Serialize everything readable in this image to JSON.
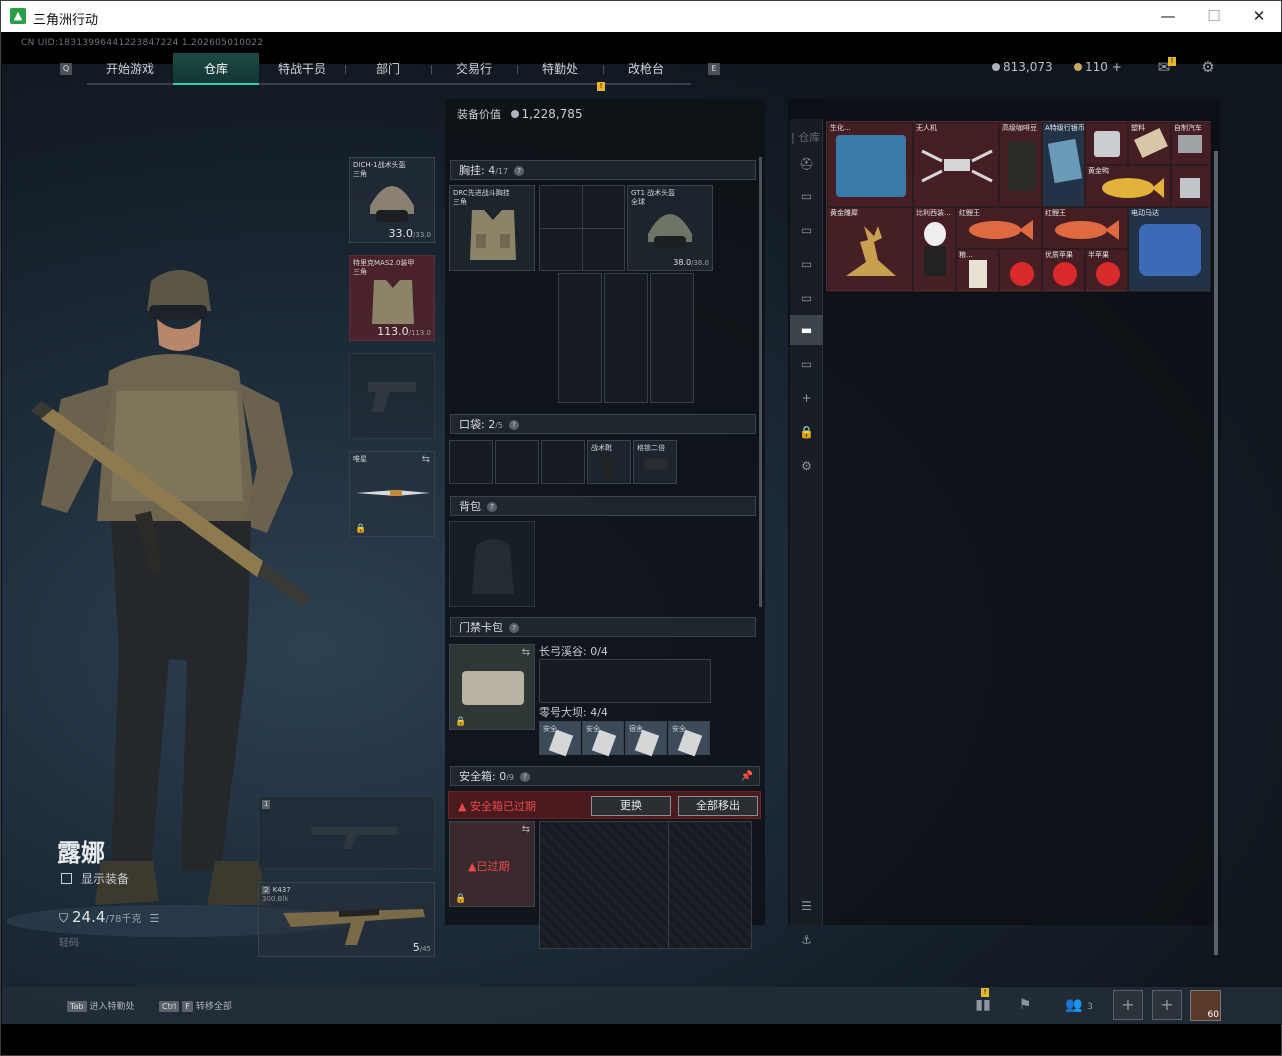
{
  "window": {
    "title": "三角洲行动",
    "minimize": "—",
    "maximize": "☐",
    "close": "✕"
  },
  "uid": "CN UID:18313996441223847224 1.202605010022",
  "nav": {
    "tabs": [
      "开始游戏",
      "仓库",
      "特战干员",
      "部门",
      "交易行",
      "特勤处",
      "改枪台"
    ],
    "active": "仓库",
    "key_left": "Q",
    "key_right": "E",
    "tejinchu_badge": "!"
  },
  "currency": {
    "coins": "813,073",
    "gold": "110",
    "plus": "+"
  },
  "header_icons": {
    "mail": "mail-icon",
    "mail_badge": "!",
    "settings": "gear-icon"
  },
  "operator": {
    "name": "露娜",
    "show_equipment": "显示装备",
    "weight": "24.4",
    "weight_max": "/78千克",
    "hint": "轻码"
  },
  "equip_slots": {
    "helmet": {
      "label": "DICH-1战术头盔\n三角",
      "value": "33.0",
      "max": "/33.0"
    },
    "armor": {
      "label": "特里克MAS2.0装甲\n三角",
      "value": "113.0",
      "max": "/113.0"
    },
    "melee": {
      "label": "唯星"
    }
  },
  "weapons": {
    "primary_num": "1",
    "secondary_num": "2",
    "secondary_name": "K437",
    "secondary_sub": "300.Blk",
    "ammo": "5",
    "ammo_max": "/45"
  },
  "loadout": {
    "value_label": "装备价值",
    "value": "1,228,785",
    "chest": {
      "label": "胸挂:",
      "count": "4",
      "max": "/17",
      "rig_name": "DRC先进战斗胸挂\n三角",
      "helmet2_name": "GT1 战术头盔\n全球",
      "helmet2_value": "38.0",
      "helmet2_max": "/38.0"
    },
    "pocket": {
      "label": "口袋:",
      "count": "2",
      "max": "/5",
      "item1": "战术靴",
      "item2": "格锁二倍"
    },
    "backpack": {
      "label": "背包"
    },
    "keycard": {
      "label": "门禁卡包",
      "row1": "长弓溪谷: 0/4",
      "row2": "零号大坝: 4/4",
      "cards": [
        "安全",
        "安全",
        "宿舍",
        "安全"
      ]
    },
    "safebox": {
      "label": "安全箱:",
      "count": "0",
      "max": "/9",
      "alert": "安全箱已过期",
      "btn_replace": "更换",
      "btn_remove": "全部移出",
      "expired": "已过期"
    }
  },
  "stash": {
    "title": "仓库",
    "items": [
      "生化...",
      "无人机",
      "高级咖啡豆",
      "A特级行银币",
      "",
      "塑料",
      "自制汽车",
      "黄金鸭",
      "黄金雕犀",
      "比利西装...",
      "红鲤王",
      "红鲤王",
      "电动马达",
      "",
      "粮...",
      "",
      "优质苹果",
      "半苹果"
    ]
  },
  "sidebar_icons": [
    "helmet-icon",
    "rifle-icon",
    "rifle-icon",
    "rifle-icon",
    "rifle-icon",
    "gun-icon",
    "gun-icon",
    "plus-icon",
    "lock-icon",
    "gear-icon",
    "layers-icon",
    "anchor-icon"
  ],
  "bottom": {
    "tab_key": "Tab",
    "tab_label": "进入特勤处",
    "ctrl_key": "Ctrl",
    "f_key": "F",
    "f_label": "转移全部",
    "friends": "3",
    "badge": "!",
    "avatar_level": "60"
  }
}
